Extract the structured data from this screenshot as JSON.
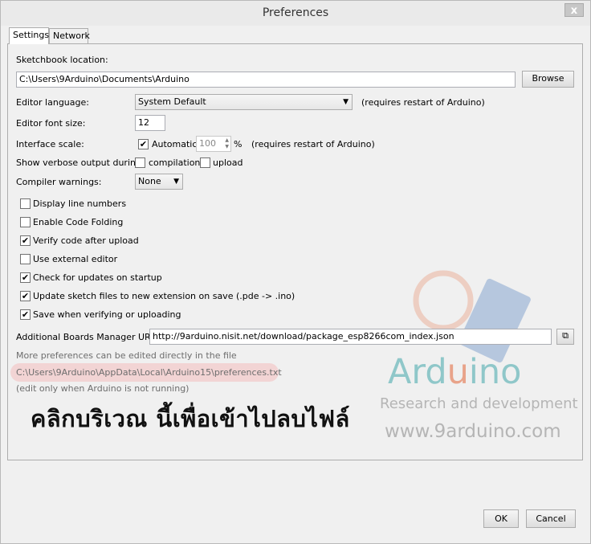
{
  "window": {
    "title": "Preferences",
    "close": "x"
  },
  "tabs": [
    {
      "label": "Settings",
      "active": true
    },
    {
      "label": "Network",
      "active": false
    }
  ],
  "settings": {
    "sketchbook_label": "Sketchbook location:",
    "sketchbook_value": "C:\\Users\\9Arduino\\Documents\\Arduino",
    "browse": "Browse",
    "language_label": "Editor language:",
    "language_value": "System Default",
    "language_note": "(requires restart of Arduino)",
    "font_size_label": "Editor font size:",
    "font_size_value": "12",
    "scale_label": "Interface scale:",
    "scale_automatic": "Automatic",
    "scale_automatic_checked": true,
    "scale_value": "100",
    "scale_unit": "%",
    "scale_note": "(requires restart of Arduino)",
    "verbose_label": "Show verbose output during:",
    "verbose_compilation": "compilation",
    "verbose_upload": "upload",
    "warnings_label": "Compiler warnings:",
    "warnings_value": "None",
    "options": [
      {
        "label": "Display line numbers",
        "checked": false
      },
      {
        "label": "Enable Code Folding",
        "checked": false
      },
      {
        "label": "Verify code after upload",
        "checked": true
      },
      {
        "label": "Use external editor",
        "checked": false
      },
      {
        "label": "Check for updates on startup",
        "checked": true
      },
      {
        "label": "Update sketch files to new extension on save (.pde -> .ino)",
        "checked": true
      },
      {
        "label": "Save when verifying or uploading",
        "checked": true
      }
    ],
    "boards_label": "Additional Boards Manager URLs:",
    "boards_value": "http://9arduino.nisit.net/download/package_esp8266com_index.json",
    "more_prefs": "More preferences can be edited directly in the file",
    "prefs_path": "C:\\Users\\9Arduino\\AppData\\Local\\Arduino15\\preferences.txt",
    "edit_note": "(edit only when Arduino is not running)"
  },
  "annotation": {
    "text": "คลิกบริเวณ นี้เพื่อเข้าไปลบไฟล์"
  },
  "watermark": {
    "brand_prefix": "Ard",
    "brand_highlight": "u",
    "brand_suffix": "ino",
    "tagline": "Research and development",
    "url": "www.9arduino.com",
    "colors": {
      "brand": "#8fc7c9",
      "highlight": "#e8a38a",
      "text": "#b5b5b5"
    }
  },
  "footer": {
    "ok": "OK",
    "cancel": "Cancel"
  }
}
